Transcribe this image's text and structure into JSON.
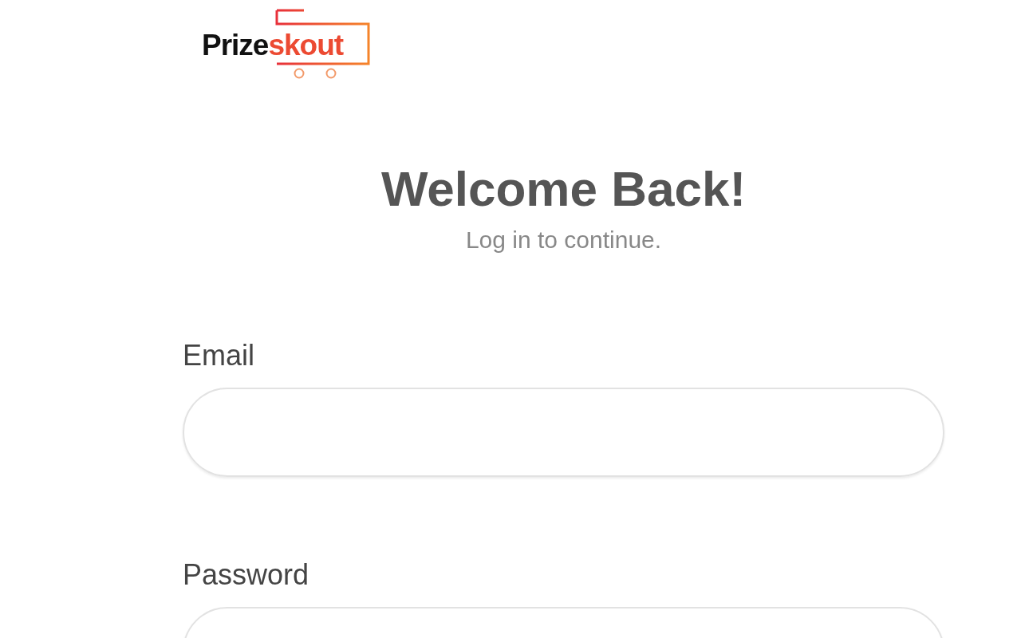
{
  "logo": {
    "part_1": "Prize",
    "part_2": "skout"
  },
  "heading": "Welcome Back!",
  "subtitle": "Log in to continue.",
  "fields": [
    {
      "label": "Email"
    },
    {
      "label": "Password"
    }
  ]
}
